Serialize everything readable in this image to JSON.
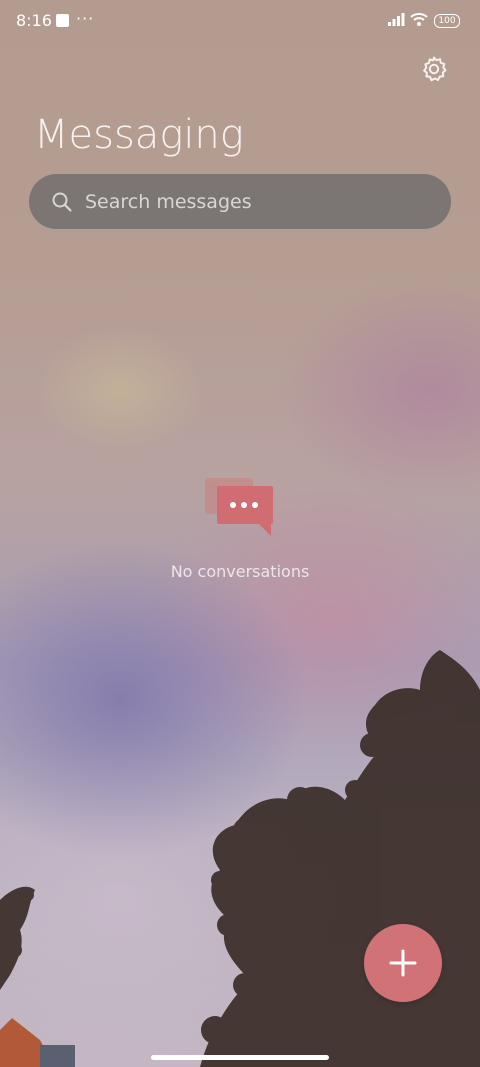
{
  "status_bar": {
    "time": "8:16",
    "dots": "···",
    "battery": "100"
  },
  "header": {
    "title": "Messaging",
    "settings_icon": "gear-icon"
  },
  "search": {
    "placeholder": "Search messages",
    "icon": "search-icon"
  },
  "empty_state": {
    "icon": "chat-bubble-icon",
    "label": "No conversations"
  },
  "fab": {
    "icon": "plus-icon"
  },
  "colors": {
    "accent": "#d07276",
    "search_bg": "#6e6e6e",
    "text_light": "#f7f2f0"
  }
}
